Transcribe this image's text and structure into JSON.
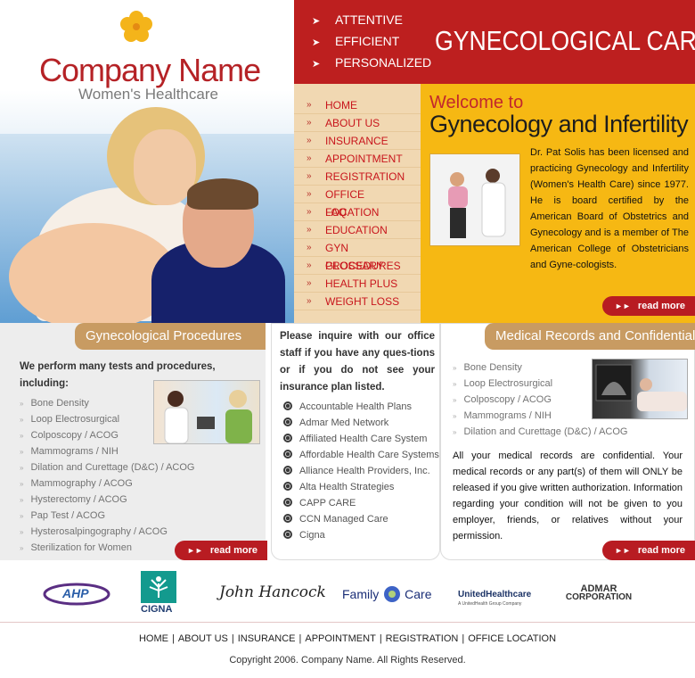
{
  "brand": {
    "company_name": "Company Name",
    "tagline": "Women's Healthcare",
    "title": "GYNECOLOGICAL CARE",
    "values": [
      "ATTENTIVE",
      "EFFICIENT",
      "PERSONALIZED"
    ],
    "colors": {
      "red": "#bd1f1f",
      "gold": "#f6b813",
      "tan": "#c89b62"
    }
  },
  "nav": {
    "items": [
      "HOME",
      "ABOUT US",
      "INSURANCE",
      "APPOINTMENT",
      "REGISTRATION",
      "OFFICE LOCATION",
      "FAQ",
      "EDUCATION",
      "GYN PROCEDURES",
      "GLOSSARY",
      "HEALTH PLUS",
      "WEIGHT LOSS"
    ]
  },
  "welcome": {
    "title_line1": "Welcome to",
    "title_line2": "Gynecology and Infertility",
    "body": "Dr. Pat Solis has been licensed and practicing Gynecology and Infertility (Women's Health Care) since 1977. He is board certified by the American Board of Obstetrics and Gynecology and is a member of The American College of Obstetricians and Gyne-cologists.",
    "read_more": "read more"
  },
  "procedures": {
    "title": "Gynecological Procedures",
    "intro": "We perform many tests and procedures, including:",
    "items": [
      "Bone Density",
      "Loop Electrosurgical",
      "Colposcopy / ACOG",
      "Mammograms / NIH",
      "Dilation and Curettage (D&C) / ACOG",
      "Mammography / ACOG",
      "Hysterectomy / ACOG",
      "Pap Test / ACOG",
      "Hysterosalpingography / ACOG",
      "Sterilization for Women"
    ],
    "read_more": "read more"
  },
  "insurance": {
    "intro": "Please inquire with our office staff if you have any ques-tions or if you do not see your insurance plan listed.",
    "plans": [
      "Accountable Health Plans",
      "Admar Med Network",
      "Affiliated Health Care System",
      "Affordable Health Care Systems",
      "Alliance Health Providers, Inc.",
      "Alta Health Strategies",
      "CAPP CARE",
      "CCN Managed Care",
      "Cigna"
    ]
  },
  "records": {
    "title": "Medical Records and Confidentiality",
    "items": [
      "Bone Density",
      "Loop Electrosurgical",
      "Colposcopy / ACOG",
      "Mammograms / NIH",
      "Dilation and Curettage (D&C) / ACOG"
    ],
    "body": "All your medical records are confidential. Your medical records or any part(s) of them will ONLY be released if you give written authorization. Information regarding your condition will not be given to you employer, friends, or relatives without your permission.",
    "read_more": "read more"
  },
  "partners": {
    "ahp": "AHP",
    "cigna": "CIGNA",
    "hancock": "John Hancock",
    "family_care_a": "Family",
    "family_care_b": "Care",
    "united": "UnitedHealthcare",
    "united_sub": "A UnitedHealth Group Company",
    "admar_a": "ADMAR",
    "admar_b": "CORPORATION"
  },
  "footer": {
    "links": [
      "HOME",
      "ABOUT US",
      "INSURANCE",
      "APPOINTMENT",
      "REGISTRATION",
      "OFFICE LOCATION"
    ],
    "copyright": "Copyright 2006. Company Name. All Rights Reserved."
  }
}
